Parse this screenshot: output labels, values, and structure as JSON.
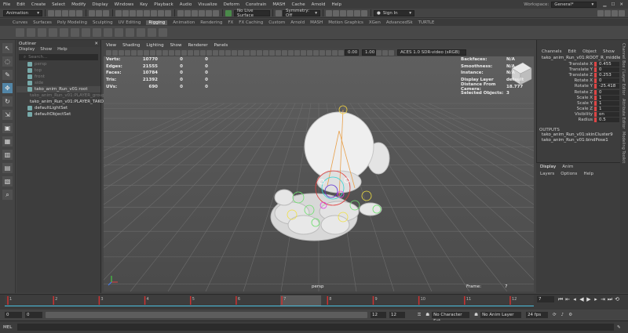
{
  "menu": {
    "items": [
      "File",
      "Edit",
      "Create",
      "Select",
      "Modify",
      "Display",
      "Windows",
      "Key",
      "Playback",
      "Audio",
      "Visualize",
      "Deform",
      "Constrain",
      "MASH",
      "Cache",
      "Arnold",
      "Help"
    ],
    "workspace_label": "Workspace:",
    "workspace_value": "General*"
  },
  "status": {
    "mode": "Animation",
    "live_surface": "No Live Surface",
    "symmetry": "Symmetry: Off",
    "sign_in": "Sign In"
  },
  "shelf_tabs": [
    {
      "label": "Curves",
      "active": false
    },
    {
      "label": "Surfaces",
      "active": false
    },
    {
      "label": "Poly Modeling",
      "active": false
    },
    {
      "label": "Sculpting",
      "active": false
    },
    {
      "label": "UV Editing",
      "active": false
    },
    {
      "label": "Rigging",
      "active": true
    },
    {
      "label": "Animation",
      "active": false
    },
    {
      "label": "Rendering",
      "active": false
    },
    {
      "label": "FX",
      "active": false
    },
    {
      "label": "FX Caching",
      "active": false
    },
    {
      "label": "Custom",
      "active": false
    },
    {
      "label": "Arnold",
      "active": false
    },
    {
      "label": "MASH",
      "active": false
    },
    {
      "label": "Motion Graphics",
      "active": false
    },
    {
      "label": "XGen",
      "active": false
    },
    {
      "label": "AdvancedSk",
      "active": false
    },
    {
      "label": "TURTLE",
      "active": false
    }
  ],
  "tools": [
    "select",
    "lasso",
    "paint",
    "move",
    "rotate",
    "scale",
    "last",
    "layout",
    "layout2",
    "layout3",
    "layout4",
    "zoom"
  ],
  "outliner": {
    "title": "Outliner",
    "menu": [
      "Display",
      "Show",
      "Help"
    ],
    "search_placeholder": "Search...",
    "items": [
      {
        "label": "persp",
        "dim": true,
        "sel": false
      },
      {
        "label": "top",
        "dim": true,
        "sel": false
      },
      {
        "label": "front",
        "dim": true,
        "sel": false
      },
      {
        "label": "side",
        "dim": true,
        "sel": false
      },
      {
        "label": "tako_anim_Run_v01:root",
        "dim": false,
        "sel": true
      },
      {
        "label": "tako_anim_Run_v01:PLAYER_grouper",
        "dim": true,
        "sel": false
      },
      {
        "label": "tako_anim_Run_v01:PLAYER_TAKO",
        "dim": false,
        "sel": false
      },
      {
        "label": "defaultLightSet",
        "dim": false,
        "sel": false
      },
      {
        "label": "defaultObjectSet",
        "dim": false,
        "sel": false
      }
    ]
  },
  "viewport": {
    "menu": [
      "View",
      "Shading",
      "Lighting",
      "Show",
      "Renderer",
      "Panels"
    ],
    "near_value": "0.00",
    "far_value": "1.00",
    "color_space": "ACES 1.0 SDR-video (sRGB)",
    "hud_left": [
      {
        "k": "Verts:",
        "v": "10770",
        "a": "0",
        "b": "0"
      },
      {
        "k": "Edges:",
        "v": "21555",
        "a": "0",
        "b": "0"
      },
      {
        "k": "Faces:",
        "v": "10784",
        "a": "0",
        "b": "0"
      },
      {
        "k": "Tris:",
        "v": "21392",
        "a": "0",
        "b": "0"
      },
      {
        "k": "UVs:",
        "v": "690",
        "a": "0",
        "b": "0"
      }
    ],
    "hud_right": [
      {
        "k": "Backfaces:",
        "v": "N/A"
      },
      {
        "k": "Smoothness:",
        "v": "N/A"
      },
      {
        "k": "Instance:",
        "v": "N/A"
      },
      {
        "k": "Display Layer",
        "v": "default"
      },
      {
        "k": "Distance From Camera:",
        "v": "18.777"
      },
      {
        "k": "Selected Objects:",
        "v": "3"
      }
    ],
    "camera_name": "persp",
    "frame_label": "Frame:",
    "frame_value": "7"
  },
  "channel_box": {
    "menu": [
      "Channels",
      "Edit",
      "Object",
      "Show"
    ],
    "object_name": "tako_anim_Run_v01:ROOT_R_middle",
    "attrs": [
      {
        "k": "Translate X",
        "v": "0.455"
      },
      {
        "k": "Translate Y",
        "v": "0"
      },
      {
        "k": "Translate Z",
        "v": "0.253"
      },
      {
        "k": "Rotate X",
        "v": "0"
      },
      {
        "k": "Rotate Y",
        "v": "-25.418"
      },
      {
        "k": "Rotate Z",
        "v": "0"
      },
      {
        "k": "Scale X",
        "v": "1"
      },
      {
        "k": "Scale Y",
        "v": "1"
      },
      {
        "k": "Scale Z",
        "v": "1"
      },
      {
        "k": "Visibility",
        "v": "on"
      },
      {
        "k": "Radius",
        "v": "0.5"
      }
    ],
    "outputs_label": "OUTPUTS",
    "outputs": [
      "tako_anim_Run_v01:skinCluster9",
      "tako_anim_Run_v01:bindPose1"
    ]
  },
  "layer_editor": {
    "tabs": [
      {
        "label": "Display",
        "active": true
      },
      {
        "label": "Anim",
        "active": false
      }
    ],
    "menu": [
      "Layers",
      "Options",
      "Help"
    ]
  },
  "right_sidebar": [
    "Channel Box / Layer Editor",
    "Attribute Editor",
    "Modeling Toolkit"
  ],
  "timeline": {
    "ticks": [
      "1",
      "2",
      "3",
      "4",
      "5",
      "6",
      "7",
      "8",
      "9",
      "10",
      "11",
      "12"
    ],
    "current_frame_marker": "7",
    "current_frame_field": "7"
  },
  "range": {
    "start_outer": "0",
    "start_inner": "0",
    "end_inner": "12",
    "end_outer": "12",
    "character_set": "No Character Set",
    "anim_layer": "No Anim Layer",
    "fps": "24 fps"
  },
  "cmdline": {
    "label": "MEL"
  },
  "colors": {
    "selection": "#5285a6",
    "timeline": "#4cc0e0",
    "key_red": "#d44444"
  }
}
